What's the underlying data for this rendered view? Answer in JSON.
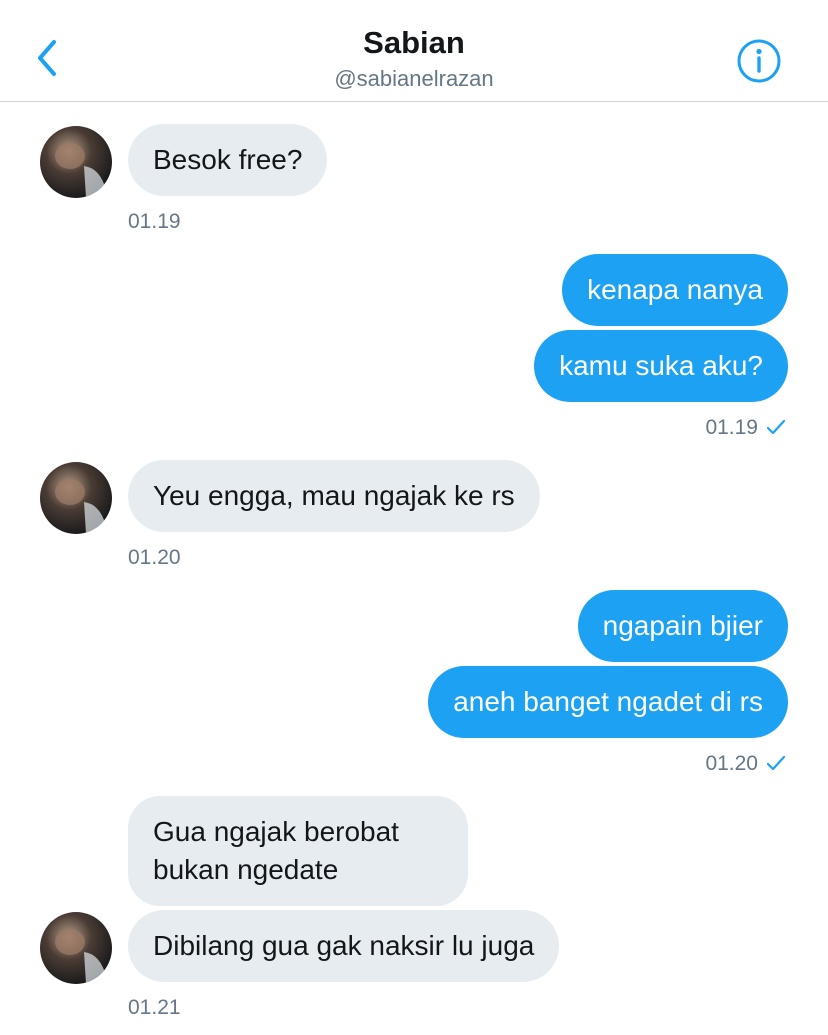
{
  "header": {
    "title": "Sabian",
    "handle": "@sabianelrazan"
  },
  "colors": {
    "accent": "#1da1f2",
    "incoming_bubble": "#e6ecf0",
    "timestamp": "#657786"
  },
  "icons": {
    "back": "chevron-left-icon",
    "info": "info-circle-icon",
    "read": "checkmark-icon"
  },
  "messages": [
    {
      "from": "them",
      "text": "Besok free?"
    },
    {
      "time": "01.19"
    },
    {
      "from": "me",
      "text": "kenapa nanya"
    },
    {
      "from": "me",
      "text": "kamu suka aku?"
    },
    {
      "time": "01.19"
    },
    {
      "from": "them",
      "text": "Yeu engga, mau ngajak ke rs"
    },
    {
      "time": "01.20"
    },
    {
      "from": "me",
      "text": "ngapain bjier"
    },
    {
      "from": "me",
      "text": "aneh banget ngadet di rs"
    },
    {
      "time": "01.20"
    },
    {
      "from": "them",
      "text": "Gua ngajak berobat bukan ngedate"
    },
    {
      "from": "them",
      "text": "Dibilang gua gak naksir lu juga"
    },
    {
      "time": "01.21"
    }
  ]
}
